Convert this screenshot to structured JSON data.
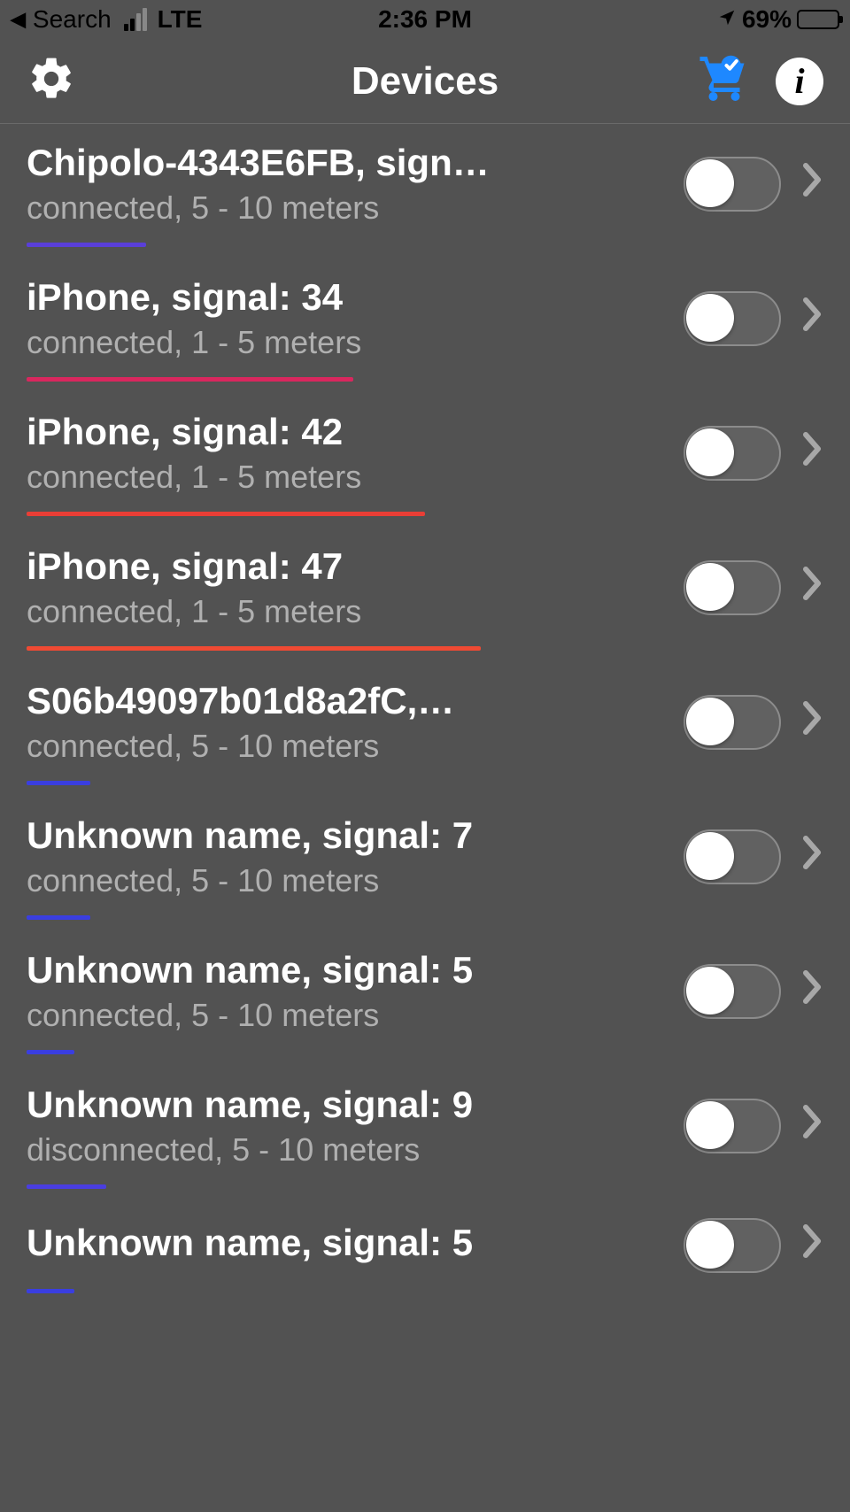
{
  "status_bar": {
    "back_label": "Search",
    "network": "LTE",
    "time": "2:36 PM",
    "battery_percent": "69%",
    "battery_level": 69
  },
  "nav": {
    "title": "Devices"
  },
  "devices": [
    {
      "title": "Chipolo-4343E6FB, sign…",
      "subtitle": "connected, 5 - 10 meters",
      "toggle": false,
      "bar_color": "#5a3fd9",
      "bar_width_pct": 15
    },
    {
      "title": "iPhone, signal: 34",
      "subtitle": "connected, 1 - 5 meters",
      "toggle": false,
      "bar_color": "#d9275e",
      "bar_width_pct": 41
    },
    {
      "title": "iPhone, signal: 42",
      "subtitle": "connected, 1 - 5 meters",
      "toggle": false,
      "bar_color": "#e93e36",
      "bar_width_pct": 50
    },
    {
      "title": "iPhone, signal: 47",
      "subtitle": "connected, 1 - 5 meters",
      "toggle": false,
      "bar_color": "#f04a33",
      "bar_width_pct": 57
    },
    {
      "title": "S06b49097b01d8a2fC,…",
      "subtitle": "connected, 5 - 10 meters",
      "toggle": false,
      "bar_color": "#3a3ee0",
      "bar_width_pct": 8
    },
    {
      "title": "Unknown name, signal: 7",
      "subtitle": "connected, 5 - 10 meters",
      "toggle": false,
      "bar_color": "#3a3ee0",
      "bar_width_pct": 8
    },
    {
      "title": "Unknown name, signal: 5",
      "subtitle": "connected, 5 - 10 meters",
      "toggle": false,
      "bar_color": "#3a3ee0",
      "bar_width_pct": 6
    },
    {
      "title": "Unknown name, signal: 9",
      "subtitle": "disconnected, 5 - 10 meters",
      "toggle": false,
      "bar_color": "#4a3ee0",
      "bar_width_pct": 10
    },
    {
      "title": "Unknown name, signal: 5",
      "subtitle": "",
      "toggle": false,
      "bar_color": "#3a3ee0",
      "bar_width_pct": 6
    }
  ]
}
